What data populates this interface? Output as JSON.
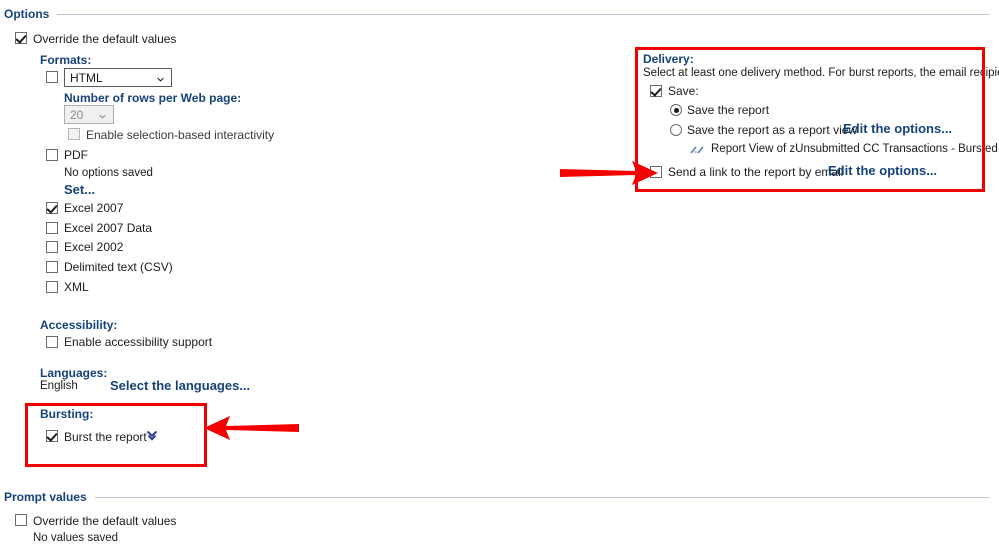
{
  "sections": {
    "options": {
      "title": "Options"
    },
    "prompt_values": {
      "title": "Prompt values"
    }
  },
  "options": {
    "override_label": "Override the default values",
    "override_checked": true,
    "formats": {
      "title": "Formats:",
      "html": {
        "checkbox_checked": false,
        "selected": "HTML",
        "rows_label": "Number of rows per Web page:",
        "rows_value": "20",
        "rows_disabled": true,
        "interactivity_label": "Enable selection-based interactivity",
        "interactivity_checked": false,
        "interactivity_disabled": true
      },
      "pdf": {
        "label": "PDF",
        "checked": false,
        "status": "No options saved",
        "set_link": "Set..."
      },
      "others": [
        {
          "label": "Excel 2007",
          "checked": true
        },
        {
          "label": "Excel 2007 Data",
          "checked": false
        },
        {
          "label": "Excel 2002",
          "checked": false
        },
        {
          "label": "Delimited text (CSV)",
          "checked": false
        },
        {
          "label": "XML",
          "checked": false
        }
      ]
    },
    "accessibility": {
      "title": "Accessibility:",
      "label": "Enable accessibility support",
      "checked": false
    },
    "languages": {
      "title": "Languages:",
      "value": "English",
      "link": "Select the languages..."
    },
    "bursting": {
      "title": "Bursting:",
      "label": "Burst the report",
      "checked": true,
      "expander_icon": "double-chevron-down-icon"
    }
  },
  "delivery": {
    "title": "Delivery:",
    "description": "Select at least one delivery method. For burst reports, the email recipients ar",
    "save": {
      "label": "Save:",
      "checked": true,
      "option_report": {
        "label": "Save the report",
        "selected": true
      },
      "option_report_view": {
        "label": "Save the report as a report view",
        "selected": false,
        "link": "Edit the options..."
      },
      "report_view_name": "Report View of zUnsubmitted CC Transactions - Bursted Repor",
      "report_view_icon": "report-view-icon"
    },
    "email": {
      "label": "Send a link to the report by email",
      "checked": false,
      "link": "Edit the options..."
    }
  },
  "prompt_values": {
    "override_label": "Override the default values",
    "override_checked": false,
    "status": "No values saved"
  },
  "annotations": {
    "highlight_color": "#f40000",
    "arrow_delivery": "arrow-pointing-right-icon",
    "arrow_bursting": "arrow-pointing-left-icon"
  },
  "colors": {
    "heading": "#15427a",
    "link": "#15427a",
    "rule": "#b9c4d2",
    "text": "#1c1c1c"
  }
}
